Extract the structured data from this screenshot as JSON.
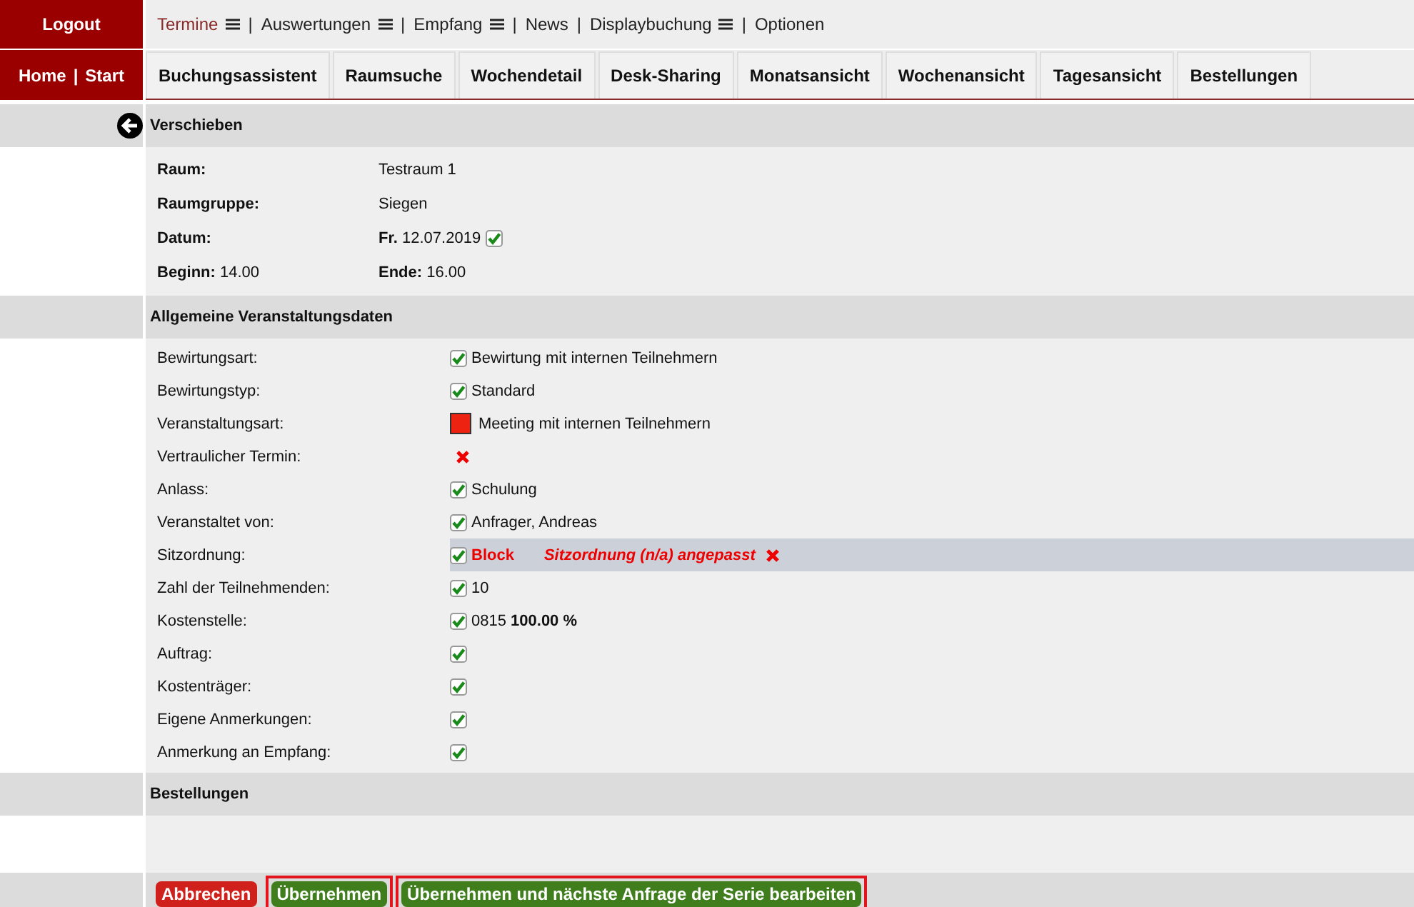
{
  "top_left": {
    "logout": "Logout",
    "home": "Home",
    "start": "Start",
    "separator": "|"
  },
  "top_links": [
    {
      "label": "Termine",
      "selected": true,
      "menu": true
    },
    {
      "label": "Auswertungen",
      "selected": false,
      "menu": true
    },
    {
      "label": "Empfang",
      "selected": false,
      "menu": true
    },
    {
      "label": "News",
      "selected": false,
      "menu": false
    },
    {
      "label": "Displaybuchung",
      "selected": false,
      "menu": true
    },
    {
      "label": "Optionen",
      "selected": false,
      "menu": false
    }
  ],
  "tabs": [
    "Buchungsassistent",
    "Raumsuche",
    "Wochendetail",
    "Desk-Sharing",
    "Monatsansicht",
    "Wochenansicht",
    "Tagesansicht",
    "Bestellungen"
  ],
  "title": "Verschieben",
  "info": {
    "room_label": "Raum:",
    "room": "Testraum 1",
    "group_label": "Raumgruppe:",
    "group": "Siegen",
    "date_label": "Datum:",
    "date_day": "Fr.",
    "date": "12.07.2019",
    "date_checked": true,
    "start_label": "Beginn:",
    "start": "14.00",
    "end_label": "Ende:",
    "end": "16.00"
  },
  "general": {
    "heading": "Allgemeine Veranstaltungsdaten",
    "fields": [
      {
        "label": "Bewirtungsart:",
        "kind": "check",
        "checked": true,
        "value": "Bewirtung mit internen Teilnehmern"
      },
      {
        "label": "Bewirtungstyp:",
        "kind": "check",
        "checked": true,
        "value": "Standard"
      },
      {
        "label": "Veranstaltungsart:",
        "kind": "color",
        "color": "#ee2211",
        "value": "Meeting mit internen Teilnehmern"
      },
      {
        "label": "Vertraulicher Termin:",
        "kind": "cross"
      },
      {
        "label": "Anlass:",
        "kind": "check",
        "checked": true,
        "value": "Schulung"
      },
      {
        "label": "Veranstaltet von:",
        "kind": "check",
        "checked": true,
        "value": "Anfrager, Andreas"
      },
      {
        "label": "Sitzordnung:",
        "kind": "warning",
        "checked": true,
        "value": "Block",
        "note": "Sitzordnung (n/a) angepasst"
      },
      {
        "label": "Zahl der Teilnehmenden:",
        "kind": "check",
        "checked": true,
        "value": "10"
      },
      {
        "label": "Kostenstelle:",
        "kind": "check",
        "checked": true,
        "value": "0815 **100.00 %**"
      },
      {
        "label": "Auftrag:",
        "kind": "check",
        "checked": true
      },
      {
        "label": "Kostenträger:",
        "kind": "check",
        "checked": true
      },
      {
        "label": "Eigene Anmerkungen:",
        "kind": "check",
        "checked": true
      },
      {
        "label": "Anmerkung an Empfang:",
        "kind": "check",
        "checked": true
      }
    ]
  },
  "orders": {
    "heading": "Bestellungen"
  },
  "buttons": [
    {
      "label": "Abbrechen",
      "kind": "cancel",
      "outlined": false
    },
    {
      "label": "Übernehmen",
      "kind": "confirm",
      "outlined": true
    },
    {
      "label": "Übernehmen und nächste Anfrage der Serie bearbeiten",
      "kind": "confirm",
      "outlined": true
    }
  ]
}
